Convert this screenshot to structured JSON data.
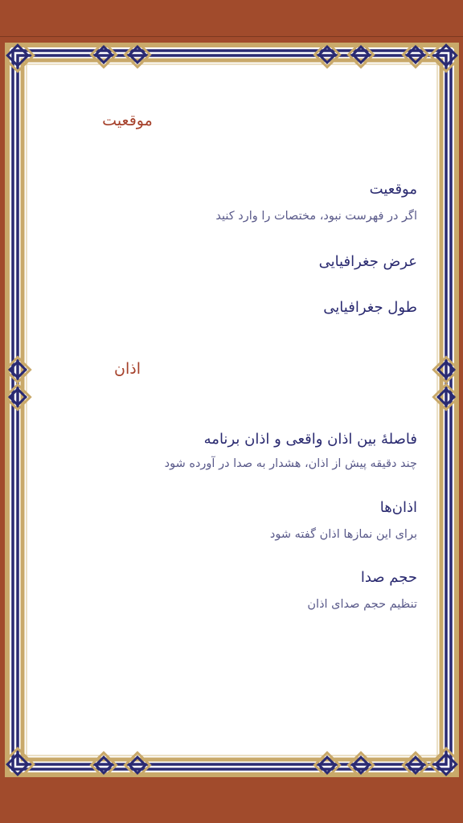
{
  "colors": {
    "status_bar": "#a14b2c",
    "background": "#a14b2c",
    "card": "#ffffff",
    "border_gold": "#c9a96a",
    "border_navy": "#2a2a72",
    "section_title": "#a5402a",
    "item_title": "#2a2a70",
    "item_summary": "#5a5a8a"
  },
  "sections": {
    "location": {
      "title": "موقعیت",
      "items": [
        {
          "title": "موقعیت",
          "summary": "اگر در فهرست نبود، مختصات را وارد کنید"
        },
        {
          "title": "عرض جغرافیایی"
        },
        {
          "title": "طول جغرافیایی"
        }
      ]
    },
    "azan": {
      "title": "اذان",
      "items": [
        {
          "title": "فاصلهٔ بین اذان واقعی و اذان برنامه",
          "summary": "چند دقیقه پیش از اذان، هشدار به صدا در آورده شود"
        },
        {
          "title": "اذان‌ها",
          "summary": "برای این نمازها اذان گفته شود"
        },
        {
          "title": "حجم صدا",
          "summary": "تنظیم حجم صدای اذان"
        }
      ]
    }
  }
}
